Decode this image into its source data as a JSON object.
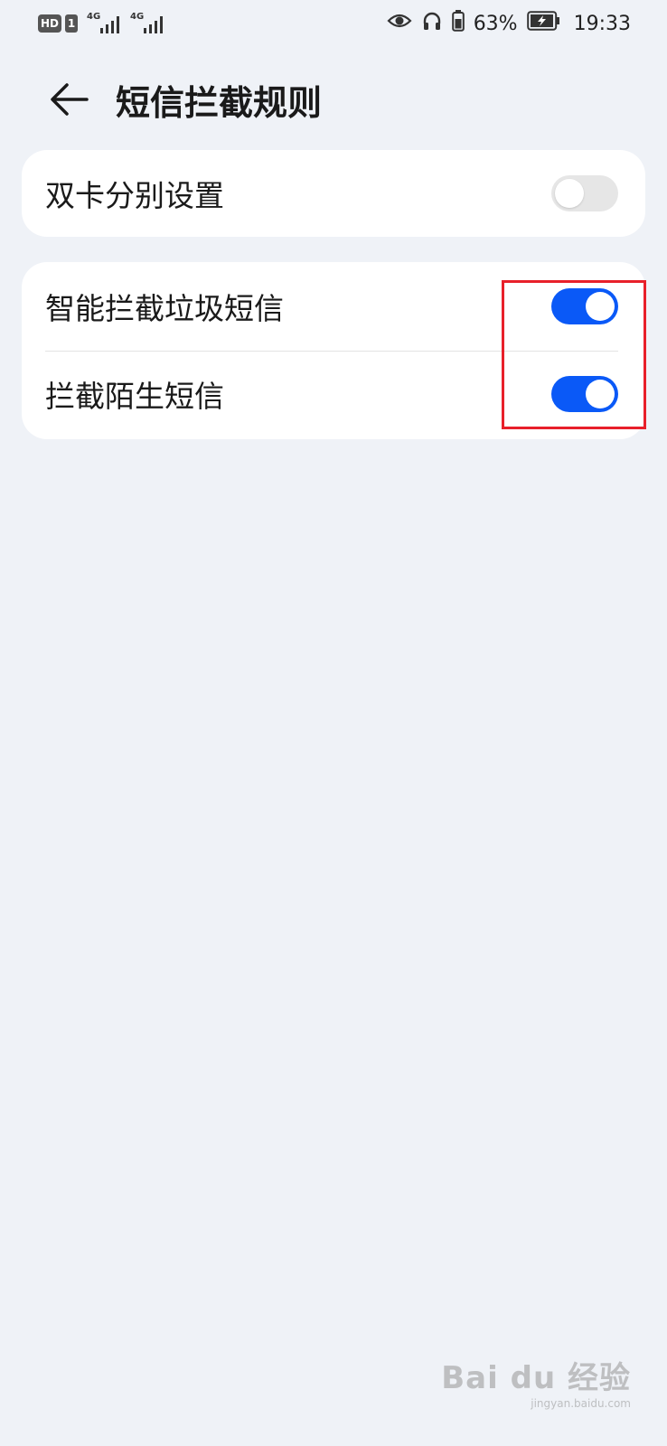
{
  "status_bar": {
    "hd": "HD",
    "sim": "1",
    "net1": "4G",
    "net2": "4G",
    "battery_percent": "63%",
    "time": "19:33"
  },
  "header": {
    "title": "短信拦截规则",
    "back_icon": "back-arrow-icon"
  },
  "settings": {
    "dual_sim": {
      "label": "双卡分别设置",
      "enabled": false
    },
    "smart_block": {
      "label": "智能拦截垃圾短信",
      "enabled": true
    },
    "block_stranger": {
      "label": "拦截陌生短信",
      "enabled": true
    }
  },
  "watermark": {
    "main": "Bai du 经验",
    "sub": "jingyan.baidu.com"
  },
  "colors": {
    "accent": "#0a59f7",
    "background": "#eff2f7",
    "highlight": "#e8202a",
    "toggle_off": "#e6e6e6"
  }
}
